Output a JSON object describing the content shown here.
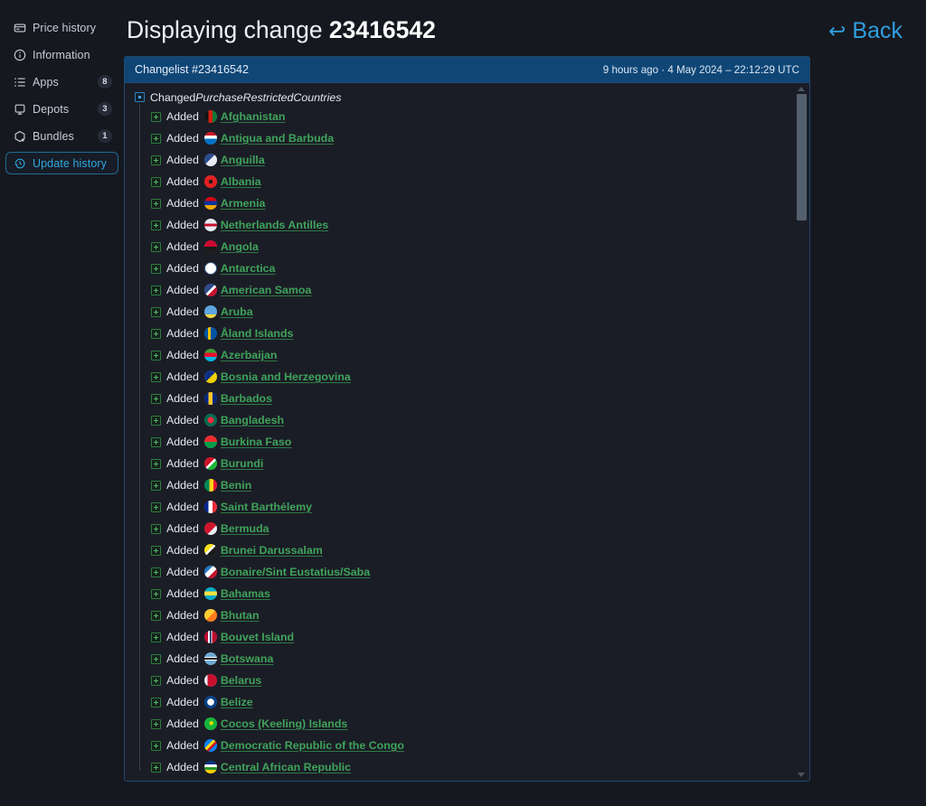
{
  "sidebar": {
    "items": [
      {
        "label": "Price history",
        "icon": "price-history-icon",
        "badge": null
      },
      {
        "label": "Information",
        "icon": "information-icon",
        "badge": null
      },
      {
        "label": "Apps",
        "icon": "apps-list-icon",
        "badge": "8"
      },
      {
        "label": "Depots",
        "icon": "depot-icon",
        "badge": "3"
      },
      {
        "label": "Bundles",
        "icon": "bundle-box-icon",
        "badge": "1"
      },
      {
        "label": "Update history",
        "icon": "history-clock-icon",
        "badge": null,
        "active": true
      }
    ]
  },
  "header": {
    "title_prefix": "Displaying change ",
    "change_id": "23416542",
    "back_label": "Back",
    "back_arrow": "↩"
  },
  "panel": {
    "title": "Changelist #23416542",
    "meta": "9 hours ago · 4 May 2024 – 22:12:29 UTC",
    "root_verb": "Changed ",
    "root_key": "PurchaseRestrictedCountries",
    "verb": "Added",
    "entries": [
      {
        "name": "Afghanistan",
        "flag": "linear-gradient(90deg,#111 0 33%,#d32011 33% 66%,#0f7a33 66%)"
      },
      {
        "name": "Antigua and Barbuda",
        "flag": "linear-gradient(180deg,#ce1126 0 30%,#ffffff 30% 55%,#0072c6 55%)"
      },
      {
        "name": "Anguilla",
        "flag": "linear-gradient(135deg,#2b4d8f 0 45%,#e8ecf2 45%)"
      },
      {
        "name": "Albania",
        "flag": "radial-gradient(circle,#1a1a1a 0 22%,#e41e20 22%)"
      },
      {
        "name": "Armenia",
        "flag": "linear-gradient(180deg,#d90012 0 33%,#0033a0 33% 66%,#f2a800 66%)"
      },
      {
        "name": "Netherlands Antilles",
        "flag": "linear-gradient(180deg,#e8ecf2 0 38%,#c8102e 38% 62%,#e8ecf2 62%)"
      },
      {
        "name": "Angola",
        "flag": "linear-gradient(180deg,#cc092f 0 50%,#1a1a1a 50%)"
      },
      {
        "name": "Antarctica",
        "flag": "radial-gradient(circle,#ffffff 0 60%,#2c4a7c 60%)"
      },
      {
        "name": "American Samoa",
        "flag": "linear-gradient(135deg,#2d4a8a 0 45%,#ffffff 45% 60%,#c8102e 60%)"
      },
      {
        "name": "Aruba",
        "flag": "linear-gradient(180deg,#5da5e0 0 70%,#f2d83f 70%)"
      },
      {
        "name": "Åland Islands",
        "flag": "linear-gradient(90deg,#0053a5 0 30%,#f5c400 30% 50%,#0053a5 50%)"
      },
      {
        "name": "Azerbaijan",
        "flag": "linear-gradient(180deg,#3f9c35 0 33%,#e8112d 33% 66%,#00b5e2 66%)"
      },
      {
        "name": "Bosnia and Herzegovina",
        "flag": "linear-gradient(135deg,#0a2f87 0 50%,#f0d000 50%)"
      },
      {
        "name": "Barbados",
        "flag": "linear-gradient(90deg,#00267f 0 33%,#ffc726 33% 66%,#00267f 66%)"
      },
      {
        "name": "Bangladesh",
        "flag": "radial-gradient(circle,#f42a41 0 35%,#006a4e 35%)"
      },
      {
        "name": "Burkina Faso",
        "flag": "linear-gradient(180deg,#ef2b2d 0 50%,#009e49 50%)"
      },
      {
        "name": "Burundi",
        "flag": "linear-gradient(135deg,#ce1126 0 45%,#ffffff 45% 58%,#1eb53a 58%)"
      },
      {
        "name": "Benin",
        "flag": "linear-gradient(90deg,#008751 0 40%,#fcd116 40% 70%,#e8112d 70%)"
      },
      {
        "name": "Saint Barthélemy",
        "flag": "linear-gradient(90deg,#002395 0 33%,#ffffff 33% 66%,#ed2939 66%)"
      },
      {
        "name": "Bermuda",
        "flag": "linear-gradient(135deg,#cf142b 0 60%,#e8ecf2 60%)"
      },
      {
        "name": "Brunei Darussalam",
        "flag": "linear-gradient(135deg,#f7e017 0 40%,#ffffff 40% 52%,#1a1a1a 52%)"
      },
      {
        "name": "Bonaire/Sint Eustatius/Saba",
        "flag": "linear-gradient(135deg,#2176c6 0 35%,#ffffff 35% 62%,#c8102e 62%)"
      },
      {
        "name": "Bahamas",
        "flag": "linear-gradient(180deg,#00abc9 0 33%,#fae042 33% 66%,#00abc9 66%)"
      },
      {
        "name": "Bhutan",
        "flag": "linear-gradient(135deg,#ffcc33 0 50%,#ff7a1a 50%)"
      },
      {
        "name": "Bouvet Island",
        "flag": "linear-gradient(90deg,#ba0c2f 0 28%,#ffffff 28% 42%,#00205b 42% 54%,#ffffff 54% 62%,#ba0c2f 62%)"
      },
      {
        "name": "Botswana",
        "flag": "linear-gradient(180deg,#6da9d2 0 36%,#ffffff 36% 44%,#1a1a1a 44% 58%,#ffffff 58% 66%,#6da9d2 66%)"
      },
      {
        "name": "Belarus",
        "flag": "linear-gradient(90deg,#e8ecf2 0 25%,#c8102e 25%)"
      },
      {
        "name": "Belize",
        "flag": "radial-gradient(circle,#ffffff 0 38%,#003f87 38%)"
      },
      {
        "name": "Cocos (Keeling) Islands",
        "flag": "radial-gradient(circle at 55% 45%,#f5d800 0 20%,#14b53a 20%)"
      },
      {
        "name": "Democratic Republic of the Congo",
        "flag": "linear-gradient(135deg,#007fff 0 36%,#f7d618 36% 52%,#ce1021 52% 66%,#007fff 66%)"
      },
      {
        "name": "Central African Republic",
        "flag": "linear-gradient(180deg,#003082 0 30%,#ffffff 30% 50%,#289728 50% 72%,#ffce00 72%)"
      }
    ]
  }
}
